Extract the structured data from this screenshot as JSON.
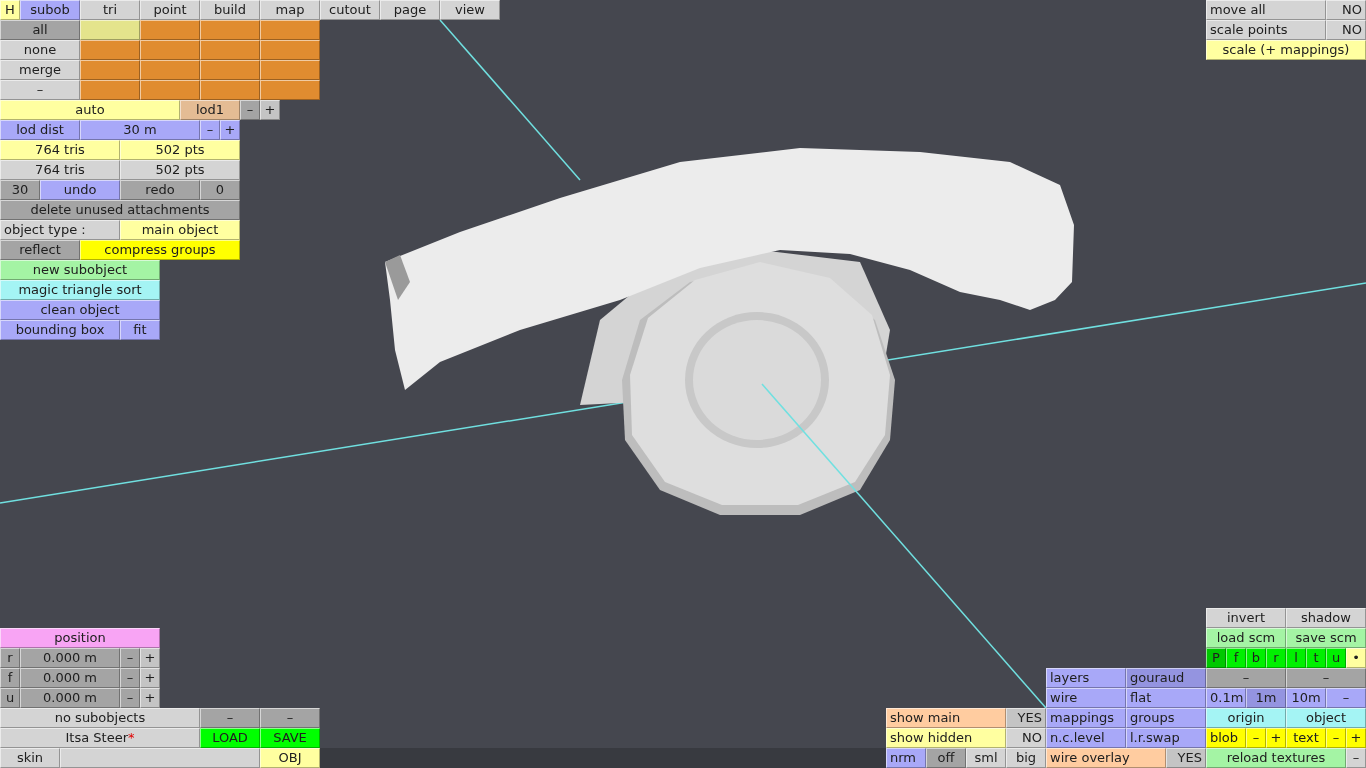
{
  "toolbar": {
    "rows": [
      {
        "buttons": [
          {
            "label": "H",
            "color": "#ffffa0"
          },
          {
            "label": "subob",
            "color": "#a8a8f8"
          },
          {
            "label": "tri",
            "color": "#d4d4d4"
          },
          {
            "label": "point",
            "color": "#d4d4d4"
          },
          {
            "label": "build",
            "color": "#d4d4d4"
          },
          {
            "label": "map",
            "color": "#d4d4d4"
          },
          {
            "label": "cutout",
            "color": "#d4d4d4"
          },
          {
            "label": "page",
            "color": "#d4d4d4"
          },
          {
            "label": "view",
            "color": "#d4d4d4"
          }
        ]
      }
    ]
  },
  "left_panel": {
    "rows": [
      {
        "buttons": [
          {
            "label": "all",
            "color": "#a4a4a4"
          },
          {
            "color": "#e4e48c"
          },
          {
            "color": "#e08c30"
          },
          {
            "color": "#e08c30"
          },
          {
            "color": "#e08c30"
          }
        ]
      },
      {
        "buttons": [
          {
            "label": "none",
            "color": "#d4d4d4"
          },
          {
            "color": "#e08c30"
          },
          {
            "color": "#e08c30"
          },
          {
            "color": "#e08c30"
          },
          {
            "color": "#e08c30"
          }
        ]
      },
      {
        "buttons": [
          {
            "label": "merge",
            "color": "#d4d4d4"
          },
          {
            "color": "#e08c30"
          },
          {
            "color": "#e08c30"
          },
          {
            "color": "#e08c30"
          },
          {
            "color": "#e08c30"
          }
        ]
      },
      {
        "buttons": [
          {
            "label": "–",
            "color": "#d4d4d4"
          },
          {
            "color": "#e08c30"
          },
          {
            "color": "#e08c30"
          },
          {
            "color": "#e08c30"
          },
          {
            "color": "#e08c30"
          }
        ]
      },
      {
        "buttons": [
          {
            "label": "auto",
            "color": "#ffffa0"
          },
          {
            "label": "lod1",
            "color": "#e4bc94"
          },
          {
            "label": "–",
            "color": "#a4a4a4"
          },
          {
            "label": "+",
            "color": "#c4c4c4"
          }
        ]
      },
      {
        "buttons": [
          {
            "label": "lod dist",
            "color": "#a8a8f8"
          },
          {
            "label": "30 m",
            "color": "#a8a8f8"
          },
          {
            "label": "–",
            "color": "#a8a8f8"
          },
          {
            "label": "+",
            "color": "#a8a8f8"
          }
        ]
      },
      {
        "buttons": [
          {
            "label": "764 tris",
            "color": "#ffffa0"
          },
          {
            "label": "502 pts",
            "color": "#ffffa0"
          }
        ]
      },
      {
        "buttons": [
          {
            "label": "764 tris",
            "color": "#d4d4d4"
          },
          {
            "label": "502 pts",
            "color": "#d4d4d4"
          }
        ]
      },
      {
        "buttons": [
          {
            "label": "30",
            "color": "#a4a4a4"
          },
          {
            "label": "undo",
            "color": "#a8a8f8"
          },
          {
            "label": "redo",
            "color": "#a4a4a4"
          },
          {
            "label": "0",
            "color": "#a4a4a4"
          }
        ]
      },
      {
        "buttons": [
          {
            "label": "delete unused attachments",
            "color": "#a4a4a4"
          }
        ]
      },
      {
        "buttons": [
          {
            "label": "object type :",
            "color": "#d4d4d4"
          },
          {
            "label": "main object",
            "color": "#ffffa0"
          }
        ]
      },
      {
        "buttons": [
          {
            "label": "reflect",
            "color": "#a4a4a4"
          },
          {
            "label": "compress groups",
            "color": "#ffff00"
          }
        ]
      },
      {
        "buttons": [
          {
            "label": "new subobject",
            "color": "#a4f4a4"
          }
        ]
      },
      {
        "buttons": [
          {
            "label": "magic triangle sort",
            "color": "#a4f4f4"
          }
        ]
      },
      {
        "buttons": [
          {
            "label": "clean object",
            "color": "#a8a8f8"
          }
        ]
      },
      {
        "buttons": [
          {
            "label": "bounding box",
            "color": "#a8a8f8"
          },
          {
            "label": "fit",
            "color": "#a8a8f8"
          }
        ]
      }
    ]
  },
  "transform_panel": {
    "rows": [
      {
        "buttons": [
          {
            "label": "move all",
            "color": "#d4d4d4"
          },
          {
            "label": "NO",
            "color": "#d4d4d4"
          }
        ]
      },
      {
        "buttons": [
          {
            "label": "scale points",
            "color": "#d4d4d4"
          },
          {
            "label": "NO",
            "color": "#d4d4d4"
          }
        ]
      },
      {
        "buttons": [
          {
            "label": "scale (+ mappings)",
            "color": "#ffffa0"
          }
        ]
      }
    ]
  },
  "position_panel": {
    "rows": [
      {
        "buttons": [
          {
            "label": "position",
            "color": "#f8a4f4"
          }
        ]
      },
      {
        "buttons": [
          {
            "label": "r",
            "color": "#a4a4a4"
          },
          {
            "label": "0.000 m",
            "color": "#a4a4a4"
          },
          {
            "label": "–",
            "color": "#a4a4a4"
          },
          {
            "label": "+",
            "color": "#c4c4c4"
          }
        ]
      },
      {
        "buttons": [
          {
            "label": "f",
            "color": "#a4a4a4"
          },
          {
            "label": "0.000 m",
            "color": "#a4a4a4"
          },
          {
            "label": "–",
            "color": "#a4a4a4"
          },
          {
            "label": "+",
            "color": "#c4c4c4"
          }
        ]
      },
      {
        "buttons": [
          {
            "label": "u",
            "color": "#a4a4a4"
          },
          {
            "label": "0.000 m",
            "color": "#a4a4a4"
          },
          {
            "label": "–",
            "color": "#a4a4a4"
          },
          {
            "label": "+",
            "color": "#c4c4c4"
          }
        ]
      },
      {
        "buttons": [
          {
            "label": "no subobjects",
            "color": "#d4d4d4"
          },
          {
            "label": "–",
            "color": "#a4a4a4"
          },
          {
            "label": "–",
            "color": "#a4a4a4"
          }
        ]
      },
      {
        "buttons": [
          {
            "label": "Itsa Steer",
            "modified_mark": "*",
            "color": "#d4d4d4"
          },
          {
            "label": "LOAD",
            "color": "#00ff00"
          },
          {
            "label": "SAVE",
            "color": "#00ff00"
          }
        ]
      },
      {
        "buttons": [
          {
            "label": "skin",
            "color": "#d4d4d4"
          },
          {
            "color": "#d4d4d4"
          },
          {
            "label": "OBJ",
            "color": "#ffffa0"
          }
        ]
      }
    ]
  },
  "display_panel": {
    "rows": [
      {
        "buttons": [
          {
            "label": "show main",
            "color": "#ffcca0"
          },
          {
            "label": "YES",
            "color": "#c4c4c4"
          }
        ]
      },
      {
        "buttons": [
          {
            "label": "show hidden",
            "color": "#ffffa0"
          },
          {
            "label": "NO",
            "color": "#d4d4d4"
          }
        ]
      },
      {
        "buttons": [
          {
            "label": "nrm",
            "color": "#a8a8f8"
          },
          {
            "label": "off",
            "color": "#a4a4a4"
          },
          {
            "label": "sml",
            "color": "#d4d4d4"
          },
          {
            "label": "big",
            "color": "#d4d4d4"
          }
        ]
      }
    ]
  },
  "render_panel": {
    "rows": [
      {
        "buttons": [
          {
            "label": "layers",
            "color": "#a8a8f8"
          },
          {
            "label": "gouraud",
            "color": "#9494e0"
          }
        ]
      },
      {
        "buttons": [
          {
            "label": "wire",
            "color": "#a8a8f8"
          },
          {
            "label": "flat",
            "color": "#a8a8f8"
          }
        ]
      },
      {
        "buttons": [
          {
            "label": "mappings",
            "color": "#a8a8f8"
          },
          {
            "label": "groups",
            "color": "#a8a8f8"
          }
        ]
      },
      {
        "buttons": [
          {
            "label": "n.c.level",
            "color": "#a8a8f8"
          },
          {
            "label": "l.r.swap",
            "color": "#a8a8f8"
          }
        ]
      },
      {
        "buttons": [
          {
            "label": "wire overlay",
            "color": "#ffcca0"
          },
          {
            "label": "YES",
            "color": "#c4c4c4"
          }
        ]
      }
    ]
  },
  "view_panel": {
    "rows": [
      {
        "buttons": [
          {
            "label": "invert",
            "color": "#d4d4d4"
          },
          {
            "label": "shadow",
            "color": "#d4d4d4"
          }
        ]
      },
      {
        "buttons": [
          {
            "label": "load scm",
            "color": "#a4f4a4"
          },
          {
            "label": "save scm",
            "color": "#a4f4a4"
          }
        ]
      },
      {
        "buttons": [
          {
            "label": "P",
            "color": "#00c800"
          },
          {
            "label": "f",
            "color": "#00f000"
          },
          {
            "label": "b",
            "color": "#00f000"
          },
          {
            "label": "r",
            "color": "#00f000"
          },
          {
            "label": "l",
            "color": "#00f000"
          },
          {
            "label": "t",
            "color": "#00f000"
          },
          {
            "label": "u",
            "color": "#00f000"
          },
          {
            "label": "•",
            "color": "#ffffa0"
          }
        ]
      },
      {
        "buttons": [
          {
            "label": "–",
            "color": "#a4a4a4"
          },
          {
            "label": "–",
            "color": "#a4a4a4"
          }
        ]
      },
      {
        "buttons": [
          {
            "label": "0.1m",
            "color": "#a8a8f8"
          },
          {
            "label": "1m",
            "color": "#9494e0"
          },
          {
            "label": "10m",
            "color": "#a8a8f8"
          },
          {
            "label": "–",
            "color": "#a8a8f8"
          }
        ]
      },
      {
        "buttons": [
          {
            "label": "origin",
            "color": "#a4f4f4"
          },
          {
            "label": "object",
            "color": "#a4f4f4"
          }
        ]
      },
      {
        "buttons": [
          {
            "label": "blob",
            "color": "#ffff00"
          },
          {
            "label": "–",
            "color": "#ffff00"
          },
          {
            "label": "+",
            "color": "#ffff00"
          },
          {
            "label": "text",
            "color": "#ffff00"
          },
          {
            "label": "–",
            "color": "#ffff00"
          },
          {
            "label": "+",
            "color": "#ffff00"
          }
        ]
      },
      {
        "buttons": [
          {
            "label": "reload textures",
            "color": "#a4f4a4"
          },
          {
            "label": "–",
            "color": "#d4d4d4"
          }
        ]
      }
    ]
  }
}
